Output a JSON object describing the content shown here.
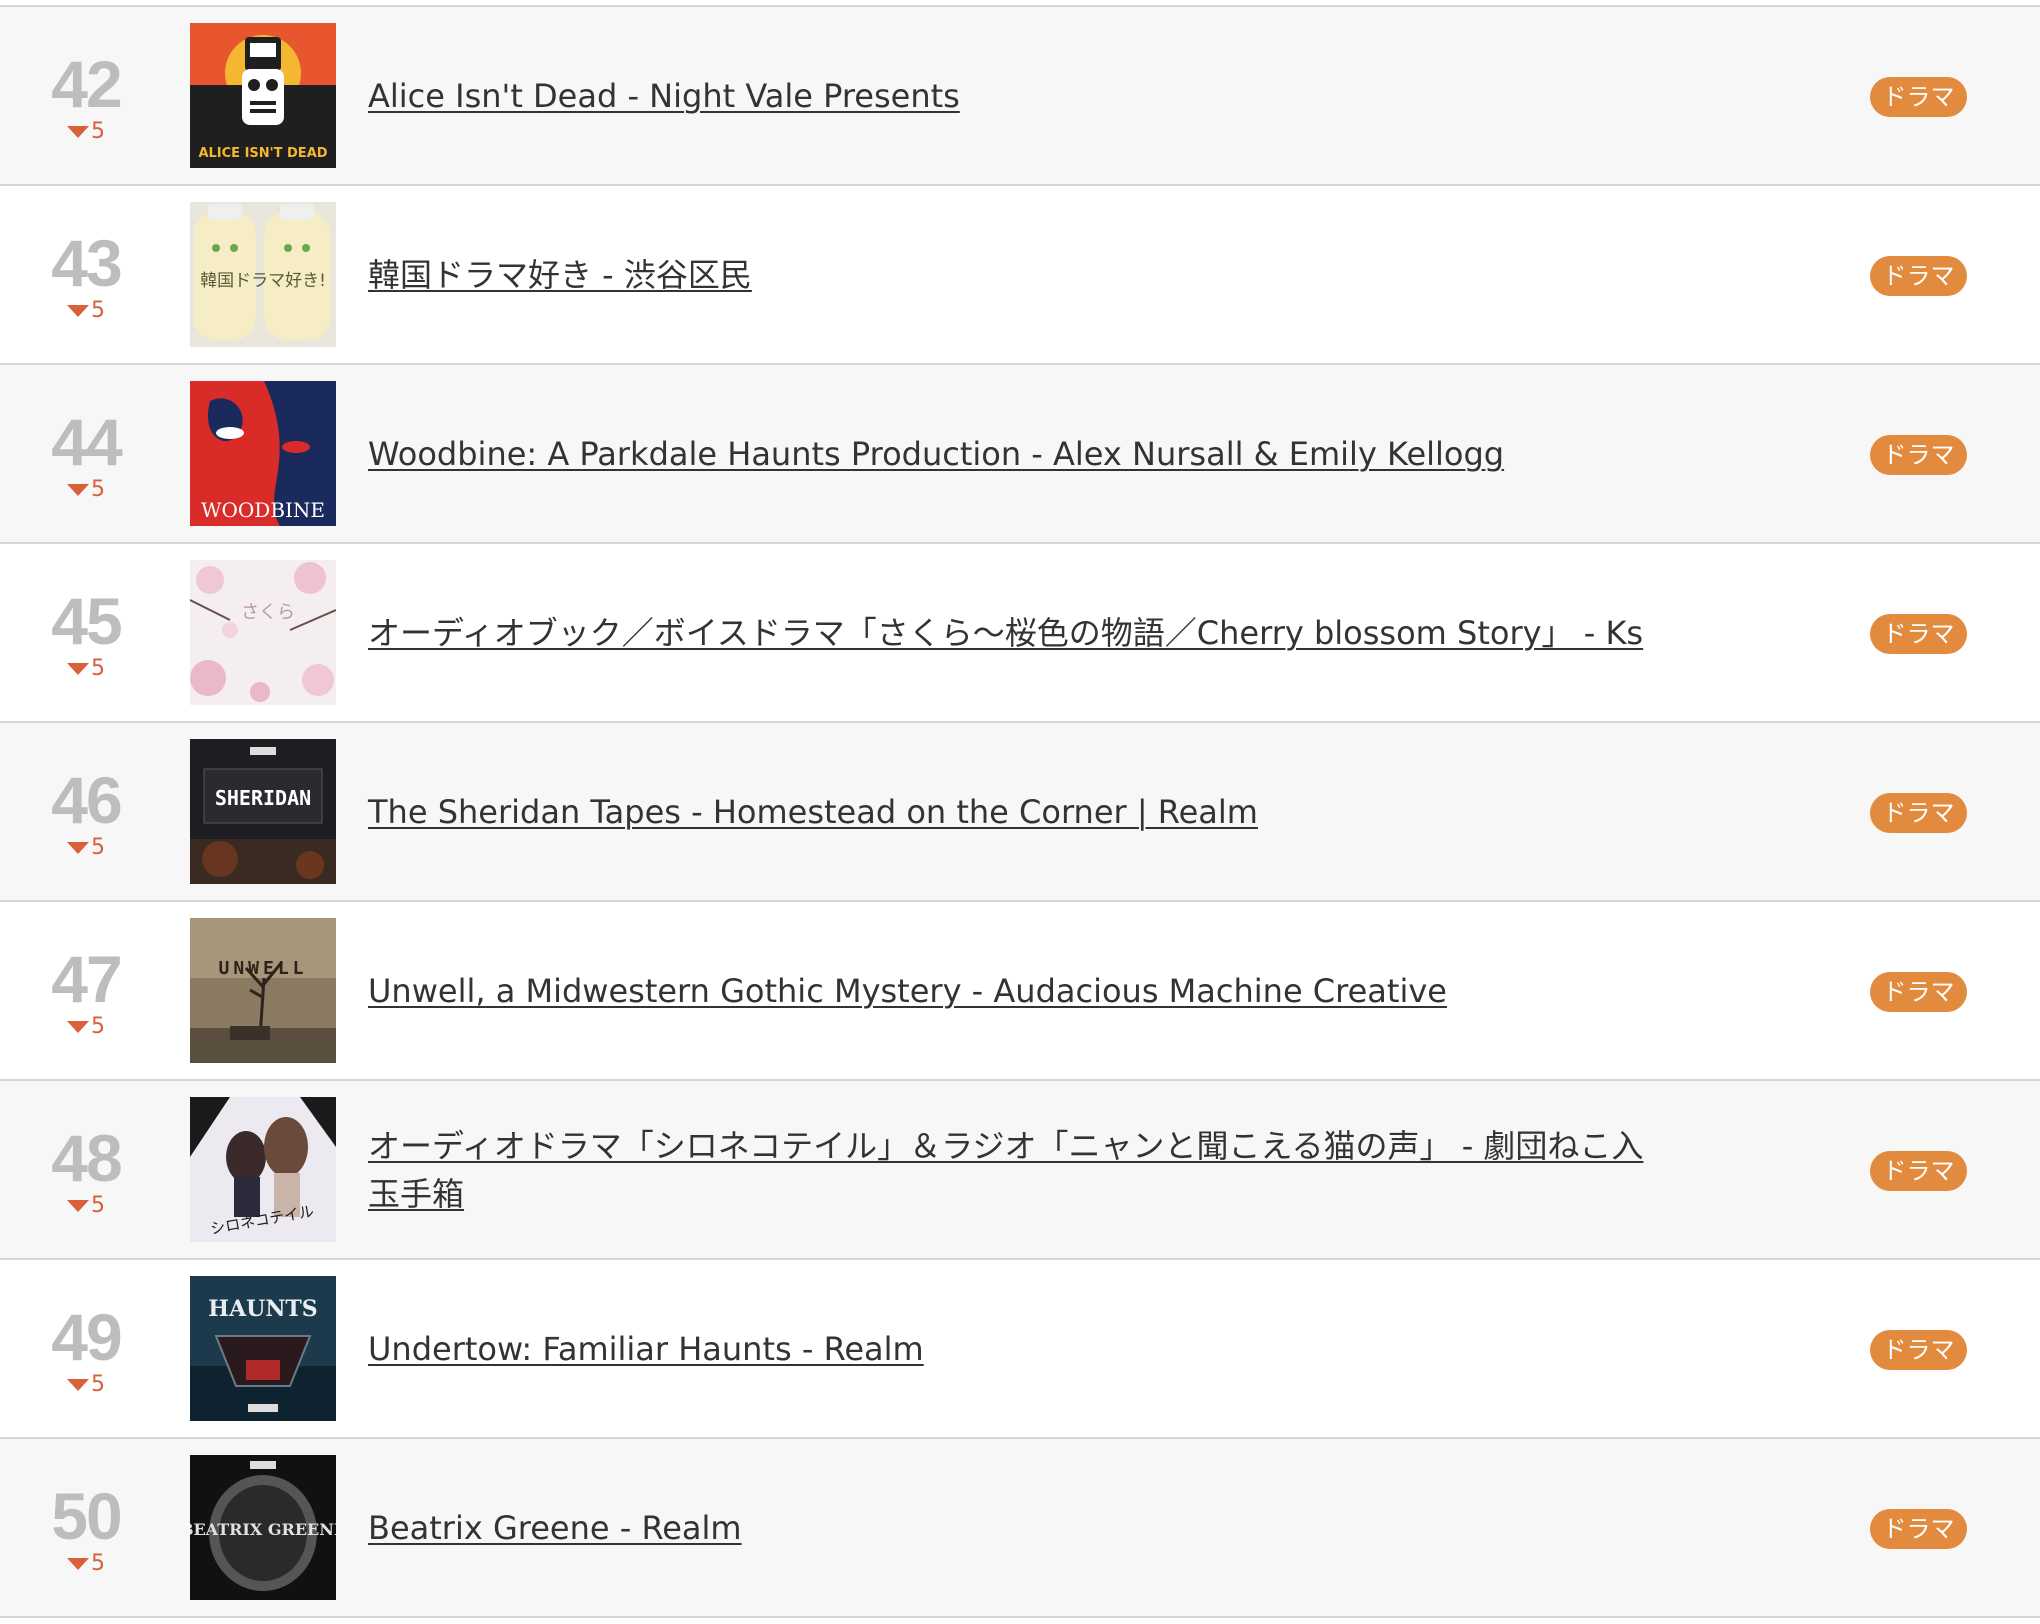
{
  "accent_color": "#e28a3d",
  "rank_change_color": "#d9603b",
  "rows": [
    {
      "rank": "42",
      "change": "5",
      "title": "Alice Isn't Dead - Night Vale Presents",
      "tag": "ドラマ",
      "art_text": "ALICE ISN'T DEAD"
    },
    {
      "rank": "43",
      "change": "5",
      "title": "韓国ドラマ好き - 渋谷区民",
      "tag": "ドラマ",
      "art_text": "韓国ドラマ好き!"
    },
    {
      "rank": "44",
      "change": "5",
      "title": "Woodbine: A Parkdale Haunts Production - Alex Nursall & Emily Kellogg",
      "tag": "ドラマ",
      "art_text": "WOODBINE"
    },
    {
      "rank": "45",
      "change": "5",
      "title": "オーディオブック／ボイスドラマ「さくら〜桜色の物語／Cherry blossom Story」 - Ks",
      "tag": "ドラマ",
      "art_text": "さくら"
    },
    {
      "rank": "46",
      "change": "5",
      "title": "The Sheridan Tapes - Homestead on the Corner | Realm",
      "tag": "ドラマ",
      "art_text": "SHERIDAN"
    },
    {
      "rank": "47",
      "change": "5",
      "title": "Unwell, a Midwestern Gothic Mystery - Audacious Machine Creative",
      "tag": "ドラマ",
      "art_text": "UNWELL"
    },
    {
      "rank": "48",
      "change": "5",
      "title": "オーディオドラマ「シロネコテイル」＆ラジオ「ニャンと聞こえる猫の声」 - 劇団ねこ入玉手箱",
      "tag": "ドラマ",
      "art_text": "シロネコテイル"
    },
    {
      "rank": "49",
      "change": "5",
      "title": "Undertow: Familiar Haunts - Realm",
      "tag": "ドラマ",
      "art_text": "HAUNTS"
    },
    {
      "rank": "50",
      "change": "5",
      "title": "Beatrix Greene - Realm",
      "tag": "ドラマ",
      "art_text": "BEATRIX GREENE"
    }
  ]
}
